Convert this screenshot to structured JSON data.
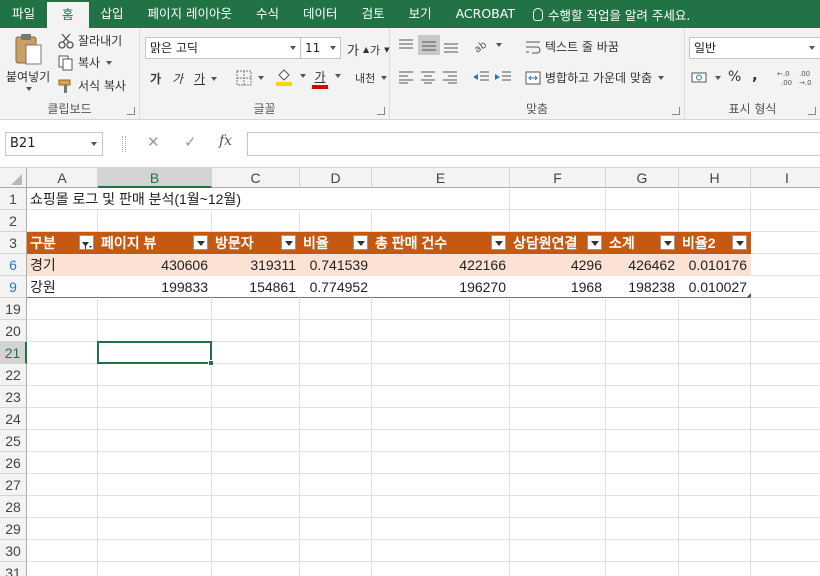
{
  "ribbon_tabs": [
    "파일",
    "홈",
    "삽입",
    "페이지 레이아웃",
    "수식",
    "데이터",
    "검토",
    "보기",
    "ACROBAT"
  ],
  "tell_me": "수행할 작업을 알려 주세요.",
  "clipboard": {
    "paste": "붙여넣기",
    "cut": "잘라내기",
    "copy": "복사",
    "format_painter": "서식 복사",
    "label": "클립보드"
  },
  "font": {
    "name": "맑은 고딕",
    "size": "11",
    "grow": "가",
    "shrink": "가",
    "bold": "가",
    "italic": "가",
    "underline": "가",
    "font_color": "가",
    "phonetic": "내천",
    "label": "글꼴",
    "highlight_color": "#ffd700",
    "text_color": "#e00000"
  },
  "alignment": {
    "wrap_text": "텍스트 줄 바꿈",
    "merge_center": "병합하고 가운데 맞춤",
    "label": "맞춤"
  },
  "number": {
    "format": "일반",
    "percent": "%",
    "comma": ",",
    "label": "표시 형식"
  },
  "formula_bar": {
    "name_box": "B21",
    "cancel": "✕",
    "enter": "✓",
    "fx": "fx",
    "value": ""
  },
  "columns": [
    "A",
    "B",
    "C",
    "D",
    "E",
    "F",
    "G",
    "H",
    "I"
  ],
  "selected_column": "B",
  "title_row": {
    "row": "1",
    "text": "쇼핑몰 로그 및 판매 분석(1월~12월)"
  },
  "empty_row_2": "2",
  "table": {
    "header_row": "3",
    "headers": [
      "구분",
      "페이지 뷰",
      "방문자",
      "비율",
      "총 판매 건수",
      "상담원연결",
      "소계",
      "비율2"
    ],
    "rows": [
      {
        "row": "6",
        "cells": [
          "경기",
          "430606",
          "319311",
          "0.741539",
          "422166",
          "4296",
          "426462",
          "0.010176"
        ]
      },
      {
        "row": "9",
        "cells": [
          "강원",
          "199833",
          "154861",
          "0.774952",
          "196270",
          "1968",
          "198238",
          "0.010027"
        ]
      }
    ]
  },
  "empty_rows": [
    "19",
    "20",
    "21",
    "22",
    "23",
    "24",
    "25",
    "26",
    "27",
    "28",
    "29",
    "30",
    "31"
  ],
  "active_row": "21",
  "accent_color": "#217346",
  "table_header_color": "#c65911",
  "table_band_color": "#fbe2d5"
}
